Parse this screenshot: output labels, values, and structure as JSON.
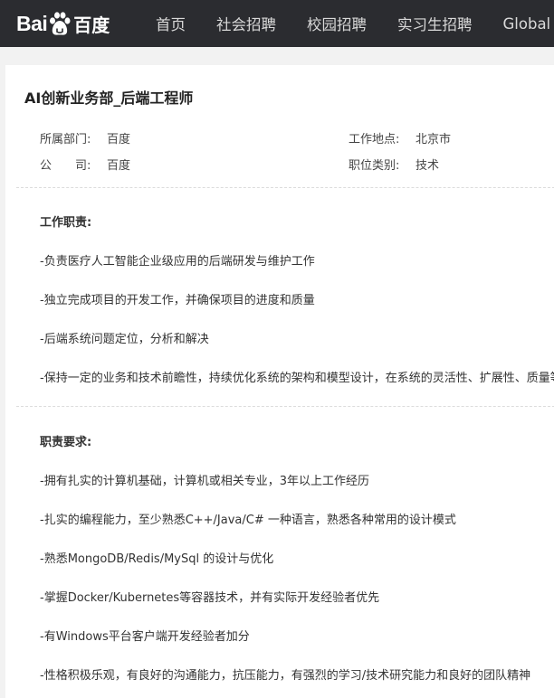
{
  "header": {
    "logo_latin": "Bai",
    "logo_cn": "百度",
    "nav": [
      "首页",
      "社会招聘",
      "校园招聘",
      "实习生招聘",
      "Global T"
    ]
  },
  "job": {
    "title": "AI创新业务部_后端工程师",
    "meta": {
      "department_label": "所属部门:",
      "department_value": "百度",
      "location_label": "工作地点:",
      "location_value": "北京市",
      "company_label": "公　　司:",
      "company_value": "百度",
      "category_label": "职位类别:",
      "category_value": "技术"
    }
  },
  "responsibilities": {
    "heading": "工作职责:",
    "items": [
      "-负责医疗人工智能企业级应用的后端研发与维护工作",
      "-独立完成项目的开发工作，并确保项目的进度和质量",
      "-后端系统问题定位，分析和解决",
      "-保持一定的业务和技术前瞻性，持续优化系统的架构和模型设计，在系统的灵活性、扩展性、质量等"
    ]
  },
  "requirements": {
    "heading": "职责要求:",
    "items": [
      "-拥有扎实的计算机基础，计算机或相关专业，3年以上工作经历",
      "-扎实的编程能力，至少熟悉C++/Java/C# 一种语言，熟悉各种常用的设计模式",
      "-熟悉MongoDB/Redis/MySql 的设计与优化",
      "-掌握Docker/Kubernetes等容器技术，并有实际开发经验者优先",
      "-有Windows平台客户端开发经验者加分",
      "-性格积极乐观，有良好的沟通能力，抗压能力，有强烈的学习/技术研究能力和良好的团队精神"
    ]
  }
}
